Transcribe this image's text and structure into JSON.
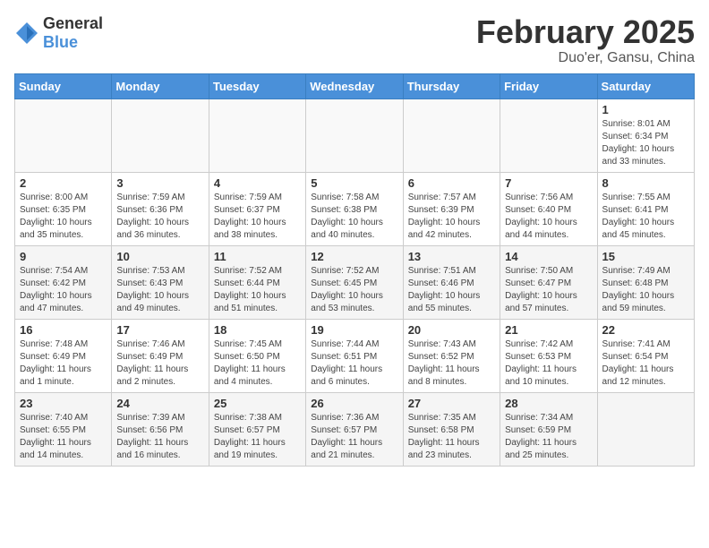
{
  "header": {
    "logo": {
      "general": "General",
      "blue": "Blue"
    },
    "title": "February 2025",
    "subtitle": "Duo'er, Gansu, China"
  },
  "weekdays": [
    "Sunday",
    "Monday",
    "Tuesday",
    "Wednesday",
    "Thursday",
    "Friday",
    "Saturday"
  ],
  "weeks": [
    [
      {
        "day": "",
        "info": ""
      },
      {
        "day": "",
        "info": ""
      },
      {
        "day": "",
        "info": ""
      },
      {
        "day": "",
        "info": ""
      },
      {
        "day": "",
        "info": ""
      },
      {
        "day": "",
        "info": ""
      },
      {
        "day": "1",
        "info": "Sunrise: 8:01 AM\nSunset: 6:34 PM\nDaylight: 10 hours\nand 33 minutes."
      }
    ],
    [
      {
        "day": "2",
        "info": "Sunrise: 8:00 AM\nSunset: 6:35 PM\nDaylight: 10 hours\nand 35 minutes."
      },
      {
        "day": "3",
        "info": "Sunrise: 7:59 AM\nSunset: 6:36 PM\nDaylight: 10 hours\nand 36 minutes."
      },
      {
        "day": "4",
        "info": "Sunrise: 7:59 AM\nSunset: 6:37 PM\nDaylight: 10 hours\nand 38 minutes."
      },
      {
        "day": "5",
        "info": "Sunrise: 7:58 AM\nSunset: 6:38 PM\nDaylight: 10 hours\nand 40 minutes."
      },
      {
        "day": "6",
        "info": "Sunrise: 7:57 AM\nSunset: 6:39 PM\nDaylight: 10 hours\nand 42 minutes."
      },
      {
        "day": "7",
        "info": "Sunrise: 7:56 AM\nSunset: 6:40 PM\nDaylight: 10 hours\nand 44 minutes."
      },
      {
        "day": "8",
        "info": "Sunrise: 7:55 AM\nSunset: 6:41 PM\nDaylight: 10 hours\nand 45 minutes."
      }
    ],
    [
      {
        "day": "9",
        "info": "Sunrise: 7:54 AM\nSunset: 6:42 PM\nDaylight: 10 hours\nand 47 minutes."
      },
      {
        "day": "10",
        "info": "Sunrise: 7:53 AM\nSunset: 6:43 PM\nDaylight: 10 hours\nand 49 minutes."
      },
      {
        "day": "11",
        "info": "Sunrise: 7:52 AM\nSunset: 6:44 PM\nDaylight: 10 hours\nand 51 minutes."
      },
      {
        "day": "12",
        "info": "Sunrise: 7:52 AM\nSunset: 6:45 PM\nDaylight: 10 hours\nand 53 minutes."
      },
      {
        "day": "13",
        "info": "Sunrise: 7:51 AM\nSunset: 6:46 PM\nDaylight: 10 hours\nand 55 minutes."
      },
      {
        "day": "14",
        "info": "Sunrise: 7:50 AM\nSunset: 6:47 PM\nDaylight: 10 hours\nand 57 minutes."
      },
      {
        "day": "15",
        "info": "Sunrise: 7:49 AM\nSunset: 6:48 PM\nDaylight: 10 hours\nand 59 minutes."
      }
    ],
    [
      {
        "day": "16",
        "info": "Sunrise: 7:48 AM\nSunset: 6:49 PM\nDaylight: 11 hours\nand 1 minute."
      },
      {
        "day": "17",
        "info": "Sunrise: 7:46 AM\nSunset: 6:49 PM\nDaylight: 11 hours\nand 2 minutes."
      },
      {
        "day": "18",
        "info": "Sunrise: 7:45 AM\nSunset: 6:50 PM\nDaylight: 11 hours\nand 4 minutes."
      },
      {
        "day": "19",
        "info": "Sunrise: 7:44 AM\nSunset: 6:51 PM\nDaylight: 11 hours\nand 6 minutes."
      },
      {
        "day": "20",
        "info": "Sunrise: 7:43 AM\nSunset: 6:52 PM\nDaylight: 11 hours\nand 8 minutes."
      },
      {
        "day": "21",
        "info": "Sunrise: 7:42 AM\nSunset: 6:53 PM\nDaylight: 11 hours\nand 10 minutes."
      },
      {
        "day": "22",
        "info": "Sunrise: 7:41 AM\nSunset: 6:54 PM\nDaylight: 11 hours\nand 12 minutes."
      }
    ],
    [
      {
        "day": "23",
        "info": "Sunrise: 7:40 AM\nSunset: 6:55 PM\nDaylight: 11 hours\nand 14 minutes."
      },
      {
        "day": "24",
        "info": "Sunrise: 7:39 AM\nSunset: 6:56 PM\nDaylight: 11 hours\nand 16 minutes."
      },
      {
        "day": "25",
        "info": "Sunrise: 7:38 AM\nSunset: 6:57 PM\nDaylight: 11 hours\nand 19 minutes."
      },
      {
        "day": "26",
        "info": "Sunrise: 7:36 AM\nSunset: 6:57 PM\nDaylight: 11 hours\nand 21 minutes."
      },
      {
        "day": "27",
        "info": "Sunrise: 7:35 AM\nSunset: 6:58 PM\nDaylight: 11 hours\nand 23 minutes."
      },
      {
        "day": "28",
        "info": "Sunrise: 7:34 AM\nSunset: 6:59 PM\nDaylight: 11 hours\nand 25 minutes."
      },
      {
        "day": "",
        "info": ""
      }
    ]
  ]
}
